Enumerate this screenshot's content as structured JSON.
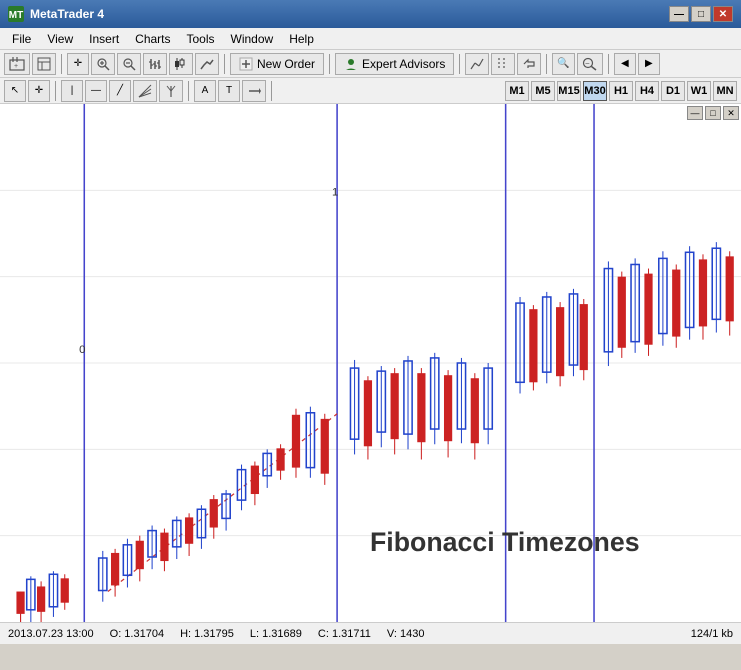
{
  "titlebar": {
    "title": "MetaTrader 4",
    "min_label": "—",
    "max_label": "□",
    "close_label": "✕"
  },
  "menubar": {
    "items": [
      "File",
      "View",
      "Insert",
      "Charts",
      "Tools",
      "Window",
      "Help"
    ]
  },
  "toolbar1": {
    "new_order_label": "New Order",
    "expert_advisors_label": "Expert Advisors"
  },
  "timeframes": {
    "items": [
      "M1",
      "M5",
      "M15",
      "M30",
      "H1",
      "H4",
      "D1",
      "W1",
      "MN"
    ],
    "active": "M30"
  },
  "chart": {
    "fib_label": "Fibonacci Timezones",
    "label_0": "0",
    "label_1": "1"
  },
  "statusbar": {
    "datetime": "2013.07.23 13:00",
    "open": "O: 1.31704",
    "high": "H: 1.31795",
    "low": "L: 1.31689",
    "close": "C: 1.31711",
    "volume": "V: 1430",
    "file_size": "124/1 kb"
  }
}
